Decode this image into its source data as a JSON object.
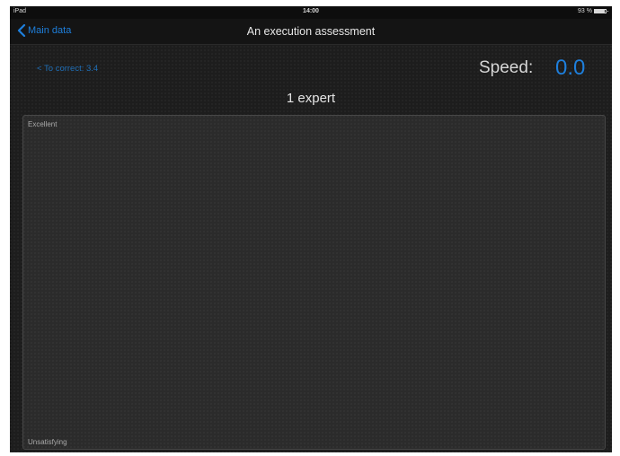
{
  "status_bar": {
    "device": "iPad",
    "time": "14:00",
    "battery": "93 %"
  },
  "nav": {
    "back_label": "Main data",
    "title": "An execution assessment"
  },
  "header": {
    "correct_link": "< To correct: 3.4",
    "speed_label": "Speed:",
    "speed_value": "0.0",
    "expert_label": "1 expert"
  },
  "panel": {
    "top_label": "Excellent",
    "bottom_label": "Unsatisfying"
  },
  "colors": {
    "accent": "#1e7fdc",
    "background": "#1d1d1d",
    "panel": "#2b2b2b"
  }
}
